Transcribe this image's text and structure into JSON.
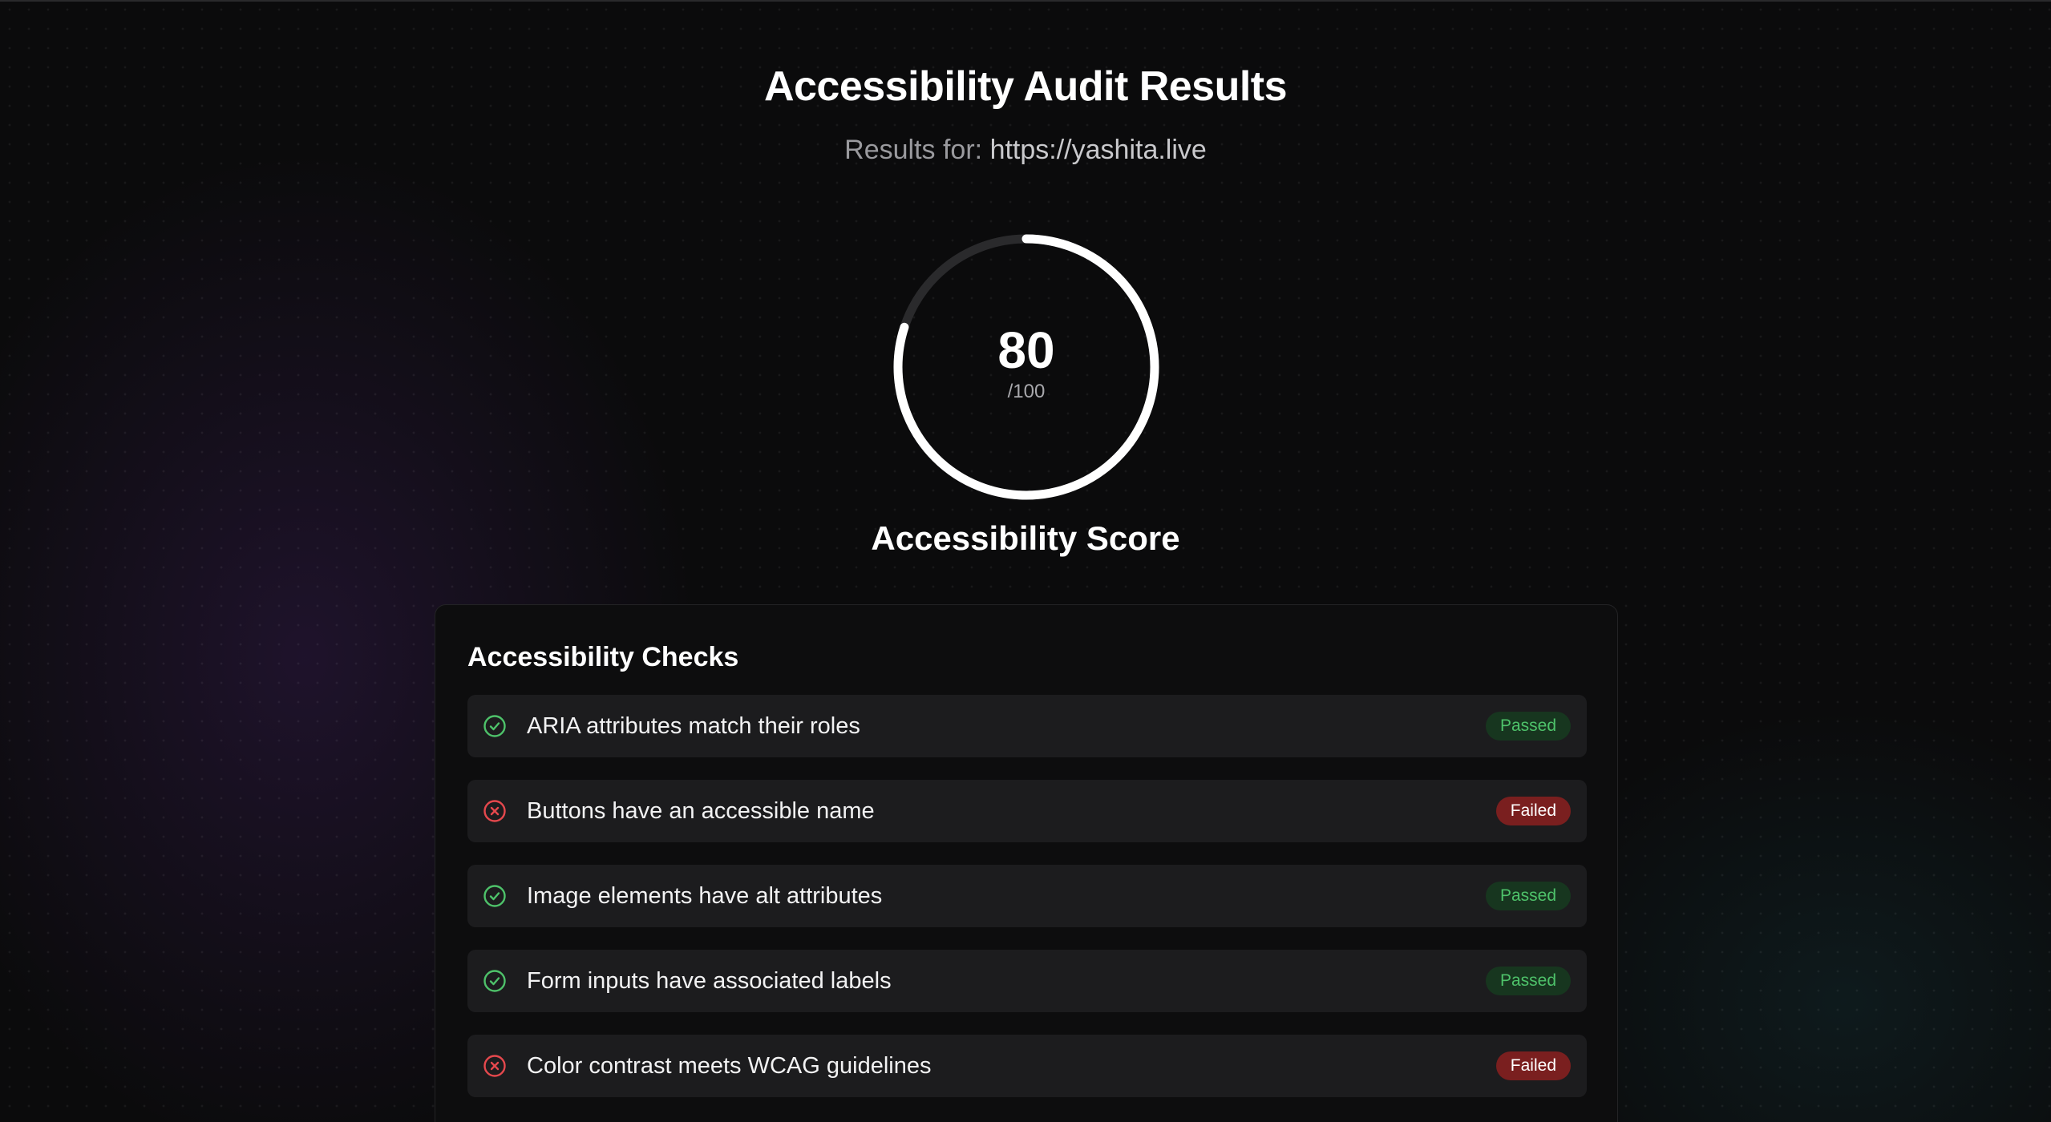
{
  "header": {
    "title": "Accessibility Audit Results",
    "results_prefix": "Results for:",
    "url": "https://yashita.live"
  },
  "score": {
    "value": "80",
    "max_label": "/100",
    "fraction": 0.8,
    "label": "Accessibility Score"
  },
  "checks": {
    "title": "Accessibility Checks",
    "items": [
      {
        "label": "ARIA attributes match their roles",
        "status": "Passed",
        "icon": "check-circle-icon"
      },
      {
        "label": "Buttons have an accessible name",
        "status": "Failed",
        "icon": "x-circle-icon"
      },
      {
        "label": "Image elements have alt attributes",
        "status": "Passed",
        "icon": "check-circle-icon"
      },
      {
        "label": "Form inputs have associated labels",
        "status": "Passed",
        "icon": "check-circle-icon"
      },
      {
        "label": "Color contrast meets WCAG guidelines",
        "status": "Failed",
        "icon": "x-circle-icon"
      }
    ]
  },
  "colors": {
    "passed": "#4ec26a",
    "failed": "#e5484d",
    "gauge_track": "#2a2a2c",
    "gauge_fill": "#ffffff"
  }
}
